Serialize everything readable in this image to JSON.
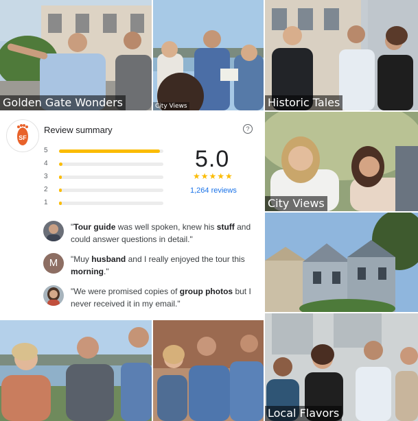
{
  "tiles": {
    "golden_gate": {
      "caption": "Golden Gate Wonders"
    },
    "city_views_small": {
      "caption": "City Views"
    },
    "historic": {
      "caption": "Historic Tales"
    },
    "city_views": {
      "caption": "City Views"
    },
    "local": {
      "caption": "Local Flavors"
    }
  },
  "review": {
    "title": "Review summary",
    "help_icon": "help-circle-icon",
    "score": "5.0",
    "stars": "★★★★★",
    "count": "1,264 reviews",
    "distribution": [
      {
        "label": "5",
        "fraction": 0.97
      },
      {
        "label": "4",
        "fraction": 0.03
      },
      {
        "label": "3",
        "fraction": 0.01
      },
      {
        "label": "2",
        "fraction": 0.01
      },
      {
        "label": "1",
        "fraction": 0.01
      }
    ],
    "quotes": [
      {
        "avatar": "photo",
        "pre": "\"",
        "b1": "Tour guide",
        "mid1": " was well spoken, knew his ",
        "b2": "stuff",
        "mid2": " and could answer questions in detail.\""
      },
      {
        "avatar": "M",
        "pre": "\"Muy ",
        "b1": "husband",
        "mid1": " and I really enjoyed the tour this ",
        "b2": "morning",
        "mid2": ".\""
      },
      {
        "avatar": "photo",
        "pre": "\"We were promised copies of ",
        "b1": "group photos",
        "mid1": " but I never received it in my email.\"",
        "b2": "",
        "mid2": ""
      }
    ]
  },
  "colors": {
    "star": "#fbbc04",
    "link": "#1a73e8",
    "logo": "#e8622a"
  }
}
